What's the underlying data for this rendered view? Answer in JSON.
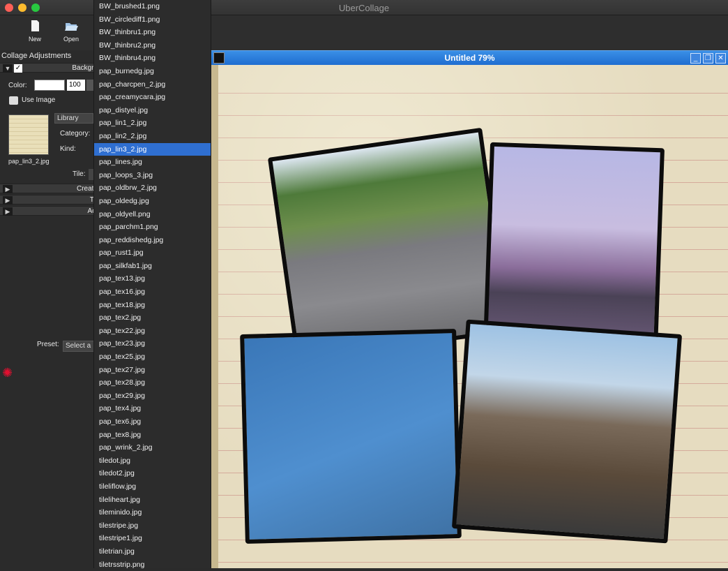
{
  "window": {
    "title": "UberCollage"
  },
  "toolbar": {
    "new_label": "New",
    "open_label": "Open"
  },
  "left_panel": {
    "title": "Collage Adjustments",
    "background_section": "Backgro",
    "color_label": "Color:",
    "color_value": "100",
    "use_image_label": "Use Image",
    "thumbnail_name": "pap_lin3_2.jpg",
    "source_select": "Library",
    "category_label": "Category:",
    "kind_label": "Kind:",
    "tile_label": "Tile:",
    "create_section": "Create",
    "tu_section": "Tu",
    "adj_section": "Adj",
    "preset_label": "Preset:",
    "preset_select": "Select a"
  },
  "dropdown": {
    "selected_index": 11,
    "items": [
      "BW_brushed1.png",
      "BW_circlediff1.png",
      "BW_thinbru1.png",
      "BW_thinbru2.png",
      "BW_thinbru4.png",
      "pap_burnedg.jpg",
      "pap_charcpen_2.jpg",
      "pap_creamycara.jpg",
      "pap_distyel.jpg",
      "pap_lin1_2.jpg",
      "pap_lin2_2.jpg",
      "pap_lin3_2.jpg",
      "pap_lines.jpg",
      "pap_loops_3.jpg",
      "pap_oldbrw_2.jpg",
      "pap_oldedg.jpg",
      "pap_oldyell.png",
      "pap_parchm1.png",
      "pap_reddishedg.jpg",
      "pap_rust1.jpg",
      "pap_silkfab1.jpg",
      "pap_tex13.jpg",
      "pap_tex16.jpg",
      "pap_tex18.jpg",
      "pap_tex2.jpg",
      "pap_tex22.jpg",
      "pap_tex23.jpg",
      "pap_tex25.jpg",
      "pap_tex27.jpg",
      "pap_tex28.jpg",
      "pap_tex29.jpg",
      "pap_tex4.jpg",
      "pap_tex6.jpg",
      "pap_tex8.jpg",
      "pap_wrink_2.jpg",
      "tiledot.jpg",
      "tiledot2.jpg",
      "tileliflow.jpg",
      "tileliheart.jpg",
      "tileminido.jpg",
      "tilestripe.jpg",
      "tilestripe1.jpg",
      "tiletrian.jpg",
      "tiletrsstrip.png"
    ]
  },
  "document": {
    "title": "Untitled 79%",
    "minimize_glyph": "_",
    "restore_glyph": "❐",
    "close_glyph": "✕"
  },
  "colors": {
    "accent": "#2f6fd1",
    "titlebar_blue": "#1f6dd0",
    "paper": "#e6dcc0",
    "gear": "#e01030"
  }
}
